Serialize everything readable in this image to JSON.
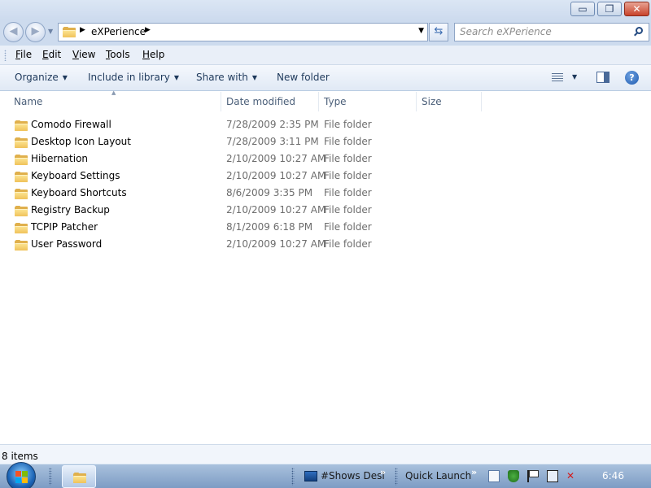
{
  "window": {
    "buttons": {
      "minimize": "▭",
      "maximize": "❐",
      "close": "✕"
    }
  },
  "address": {
    "crumbs": [
      "eXPerience"
    ],
    "search_placeholder": "Search eXPerience"
  },
  "menu": {
    "items": [
      {
        "label": "File",
        "underline": "F"
      },
      {
        "label": "Edit",
        "underline": "E"
      },
      {
        "label": "View",
        "underline": "V"
      },
      {
        "label": "Tools",
        "underline": "T"
      },
      {
        "label": "Help",
        "underline": "H"
      }
    ]
  },
  "commands": {
    "organize": "Organize",
    "include_in_library": "Include in library",
    "share_with": "Share with",
    "new_folder": "New folder",
    "help": "?"
  },
  "columns": {
    "name": "Name",
    "date_modified": "Date modified",
    "type": "Type",
    "size": "Size"
  },
  "files": [
    {
      "name": "Comodo Firewall",
      "date": "7/28/2009 2:35 PM",
      "type": "File folder"
    },
    {
      "name": "Desktop Icon Layout",
      "date": "7/28/2009 3:11 PM",
      "type": "File folder"
    },
    {
      "name": "Hibernation",
      "date": "2/10/2009 10:27 AM",
      "type": "File folder"
    },
    {
      "name": "Keyboard Settings",
      "date": "2/10/2009 10:27 AM",
      "type": "File folder"
    },
    {
      "name": "Keyboard Shortcuts",
      "date": "8/6/2009 3:35 PM",
      "type": "File folder"
    },
    {
      "name": "Registry Backup",
      "date": "2/10/2009 10:27 AM",
      "type": "File folder"
    },
    {
      "name": "TCPIP Patcher",
      "date": "8/1/2009 6:18 PM",
      "type": "File folder"
    },
    {
      "name": "User Password",
      "date": "2/10/2009 10:27 AM",
      "type": "File folder"
    }
  ],
  "status": {
    "item_count": "8 items"
  },
  "taskbar": {
    "show_desktop": "#Shows Desl",
    "quick_launch": "Quick Launch",
    "clock": "6:46",
    "chevron": "»"
  },
  "colors": {
    "titlebar": "#cddbee",
    "accent": "#1e395b",
    "folder": "#f0c25a",
    "taskbar": "#7d9cc4"
  }
}
